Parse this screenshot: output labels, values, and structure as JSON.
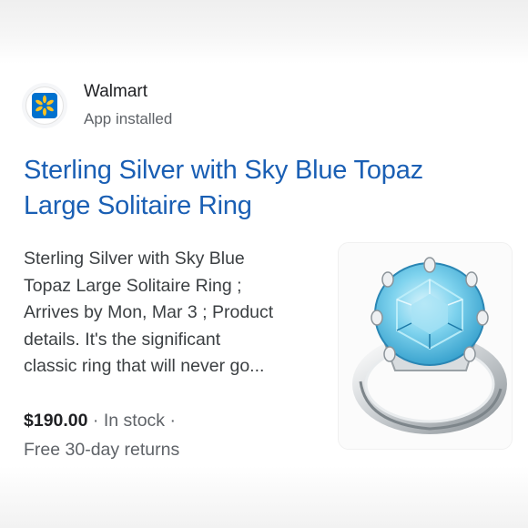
{
  "result": {
    "source": {
      "name": "Walmart",
      "subtitle": "App installed",
      "logo_icon": "walmart-spark-icon",
      "logo_color": "#ffc220",
      "logo_bg": "#0071ce"
    },
    "title_line1": "Sterling Silver with Sky Blue Topaz",
    "title_line2": "Large Solitaire Ring",
    "description": [
      "Sterling Silver with Sky Blue",
      "Topaz Large Solitaire Ring ;",
      "Arrives by Mon, Mar 3 ; Product",
      "details. It's the significant",
      "classic ring that will never go..."
    ],
    "price": "$190.00",
    "separator": " · ",
    "availability": "In stock",
    "trailing_separator": " ·",
    "returns": "Free 30-day returns",
    "image_icon": "topaz-ring-image",
    "colors": {
      "title": "#1a5fb4",
      "gem": "#5ec4e6"
    }
  }
}
